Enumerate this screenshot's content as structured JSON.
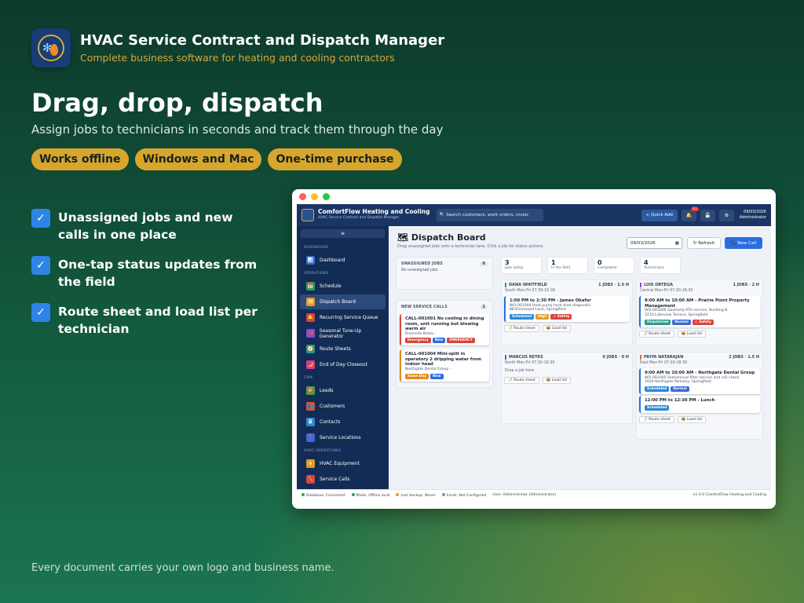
{
  "hero": {
    "app_title": "HVAC Service Contract and Dispatch Manager",
    "app_subtitle": "Complete business software for heating and cooling contractors",
    "headline": "Drag, drop, dispatch",
    "subheadline": "Assign jobs to technicians in seconds and track them through the day",
    "pills": [
      "Works offline",
      "Windows and Mac",
      "One-time purchase"
    ],
    "features": [
      "Unassigned jobs and new calls in one place",
      "One-tap status updates from the field",
      "Route sheet and load list per technician"
    ],
    "footer": "Every document carries your own logo and business name.",
    "check_glyph": "✓"
  },
  "app": {
    "name": "ComfortFlow Heating and Cooling",
    "tagline": "HVAC Service Contract and Dispatch Manager",
    "search_placeholder": "Search customers, work orders, invoic",
    "quick_add": "+ Quick Add",
    "notif_count": "11",
    "date": "09/03/2026",
    "role": "Administrator"
  },
  "sidebar": {
    "collapse": "≡",
    "sections": [
      {
        "title": "DASHBOARD",
        "items": [
          {
            "label": "Dashboard",
            "icon": "📊",
            "color": "#2a6de0"
          }
        ]
      },
      {
        "title": "OPERATIONS",
        "items": [
          {
            "label": "Schedule",
            "icon": "📅",
            "color": "#2aa35a"
          },
          {
            "label": "Dispatch Board",
            "icon": "🗺",
            "color": "#e09a2a",
            "active": true
          },
          {
            "label": "Recurring Service Queue",
            "icon": "🔔",
            "color": "#d9443a"
          },
          {
            "label": "Seasonal Tune-Up Generator",
            "icon": "🍂",
            "color": "#8a4ad9"
          },
          {
            "label": "Route Sheets",
            "icon": "🧭",
            "color": "#2a9a8a"
          },
          {
            "label": "End of Day Closeout",
            "icon": "🌙",
            "color": "#d93a8a"
          }
        ]
      },
      {
        "title": "CRM",
        "items": [
          {
            "label": "Leads",
            "icon": "🎯",
            "color": "#4aa33a"
          },
          {
            "label": "Customers",
            "icon": "👥",
            "color": "#e0502a"
          },
          {
            "label": "Contacts",
            "icon": "📇",
            "color": "#2a8ad9"
          },
          {
            "label": "Service Locations",
            "icon": "📍",
            "color": "#3a6ad9"
          }
        ]
      },
      {
        "title": "HVAC OPERATIONS",
        "items": [
          {
            "label": "HVAC Equipment",
            "icon": "❄",
            "color": "#e09a2a"
          },
          {
            "label": "Service Calls",
            "icon": "🔧",
            "color": "#d9443a"
          }
        ]
      }
    ]
  },
  "dispatch": {
    "title": "Dispatch Board",
    "title_icon": "🗺",
    "subtitle": "Drag unassigned jobs onto a technician lane. Click a job for status actions.",
    "date": "09/03/2026",
    "refresh": "↻ Refresh",
    "new_call": "📞 New Call",
    "unassigned": {
      "title": "UNASSIGNED JOBS",
      "count": "0",
      "empty": "No unassigned jobs"
    },
    "new_service_calls": {
      "title": "NEW SERVICE CALLS",
      "count": "2",
      "calls": [
        {
          "title": "CALL-001001 No cooling in dining room, unit running but blowing warm air",
          "customer": "Riverside Bistro -",
          "tags": [
            {
              "t": "Emergency",
              "c": "#d9443a"
            },
            {
              "t": "New",
              "c": "#2a6de0"
            },
            {
              "t": "EMERGENCY",
              "c": "#d9443a"
            }
          ],
          "border": "#d9443a"
        },
        {
          "title": "CALL-001004 Mini-split in operatory 2 dripping water from indoor head",
          "customer": "Northgate Dental Group -",
          "tags": [
            {
              "t": "Same Day",
              "c": "#e08a1a"
            },
            {
              "t": "New",
              "c": "#2a6de0"
            }
          ],
          "border": "#e08a1a"
        }
      ]
    },
    "kpis": [
      {
        "value": "3",
        "label": "Jobs today"
      },
      {
        "value": "1",
        "label": "In the field"
      },
      {
        "value": "0",
        "label": "Completed"
      },
      {
        "value": "4",
        "label": "Technicians"
      }
    ],
    "lanes": [
      {
        "name": "DANA WHITFIELD",
        "jobs": "1 JOBS · 1.5 H",
        "shift": "South Mon-Fri 07:30-16:30",
        "color": "#2aa35a",
        "cards": [
          {
            "time": "1:00 PM to 2:30 PM - James Okafor",
            "l1": "WO-001004 Heat pump hard start diagnostic",
            "l2": "88 Birchwood Lane, Springfield",
            "tags": [
              {
                "t": "Scheduled",
                "c": "#2a8ad9"
              },
              {
                "t": "High",
                "c": "#e09a2a"
              },
              {
                "t": "⚠ Safety",
                "c": "#d9443a"
              }
            ]
          }
        ]
      },
      {
        "name": "LUIS ORTEGA",
        "jobs": "1 JOBS · 2 H",
        "shift": "Central Mon-Fri 07:30-16:30",
        "color": "#8a4ad9",
        "cards": [
          {
            "time": "8:00 AM to 10:00 AM - Prairie Point Property Management",
            "l1": "WO-001006 Quarterly RTU service, Building B",
            "l2": "2210 Lakeview Terrace, Springfield",
            "tags": [
              {
                "t": "Dispatched",
                "c": "#2a9a8a"
              },
              {
                "t": "Normal",
                "c": "#3a6ad9"
              },
              {
                "t": "⚠ Safety",
                "c": "#d9443a"
              }
            ]
          }
        ]
      },
      {
        "name": "MARCUS REYES",
        "jobs": "0 JOBS · 0 H",
        "shift": "North Mon-Fri 07:30-16:30",
        "color": "#3a6ad9",
        "empty": "Drop a job here",
        "cards": []
      },
      {
        "name": "PRIYA NATARAJAN",
        "jobs": "2 JOBS · 1.5 H",
        "shift": "East Mon-Fri 07:30-16:30",
        "color": "#e0702a",
        "cards": [
          {
            "time": "9:00 AM to 10:00 AM - Northgate Dental Group",
            "l1": "WO-001005 Semiannual filter service and coil check",
            "l2": "2020 Northgate Parkway, Springfield",
            "tags": [
              {
                "t": "Scheduled",
                "c": "#2a8ad9"
              },
              {
                "t": "Normal",
                "c": "#3a6ad9"
              }
            ]
          },
          {
            "time": "12:00 PM to 12:30 PM - Lunch",
            "l1": "",
            "l2": "",
            "tags": [
              {
                "t": "Scheduled",
                "c": "#2a8ad9"
              }
            ]
          }
        ]
      }
    ],
    "route_sheet": "📝 Route sheet",
    "load_list": "📦 Load list"
  },
  "status_bar": {
    "items": [
      {
        "t": "Database: Connected",
        "c": "#2aa35a"
      },
      {
        "t": "Mode: Offline local",
        "c": "#2aa35a"
      },
      {
        "t": "Last backup: Never",
        "c": "#e09a2a"
      },
      {
        "t": "Email: Not Configured",
        "c": "#8892a0"
      }
    ],
    "user": "User: Administrator (Administrator)",
    "version": "v1.0.0 ComfortFlow Heating and Cooling"
  }
}
